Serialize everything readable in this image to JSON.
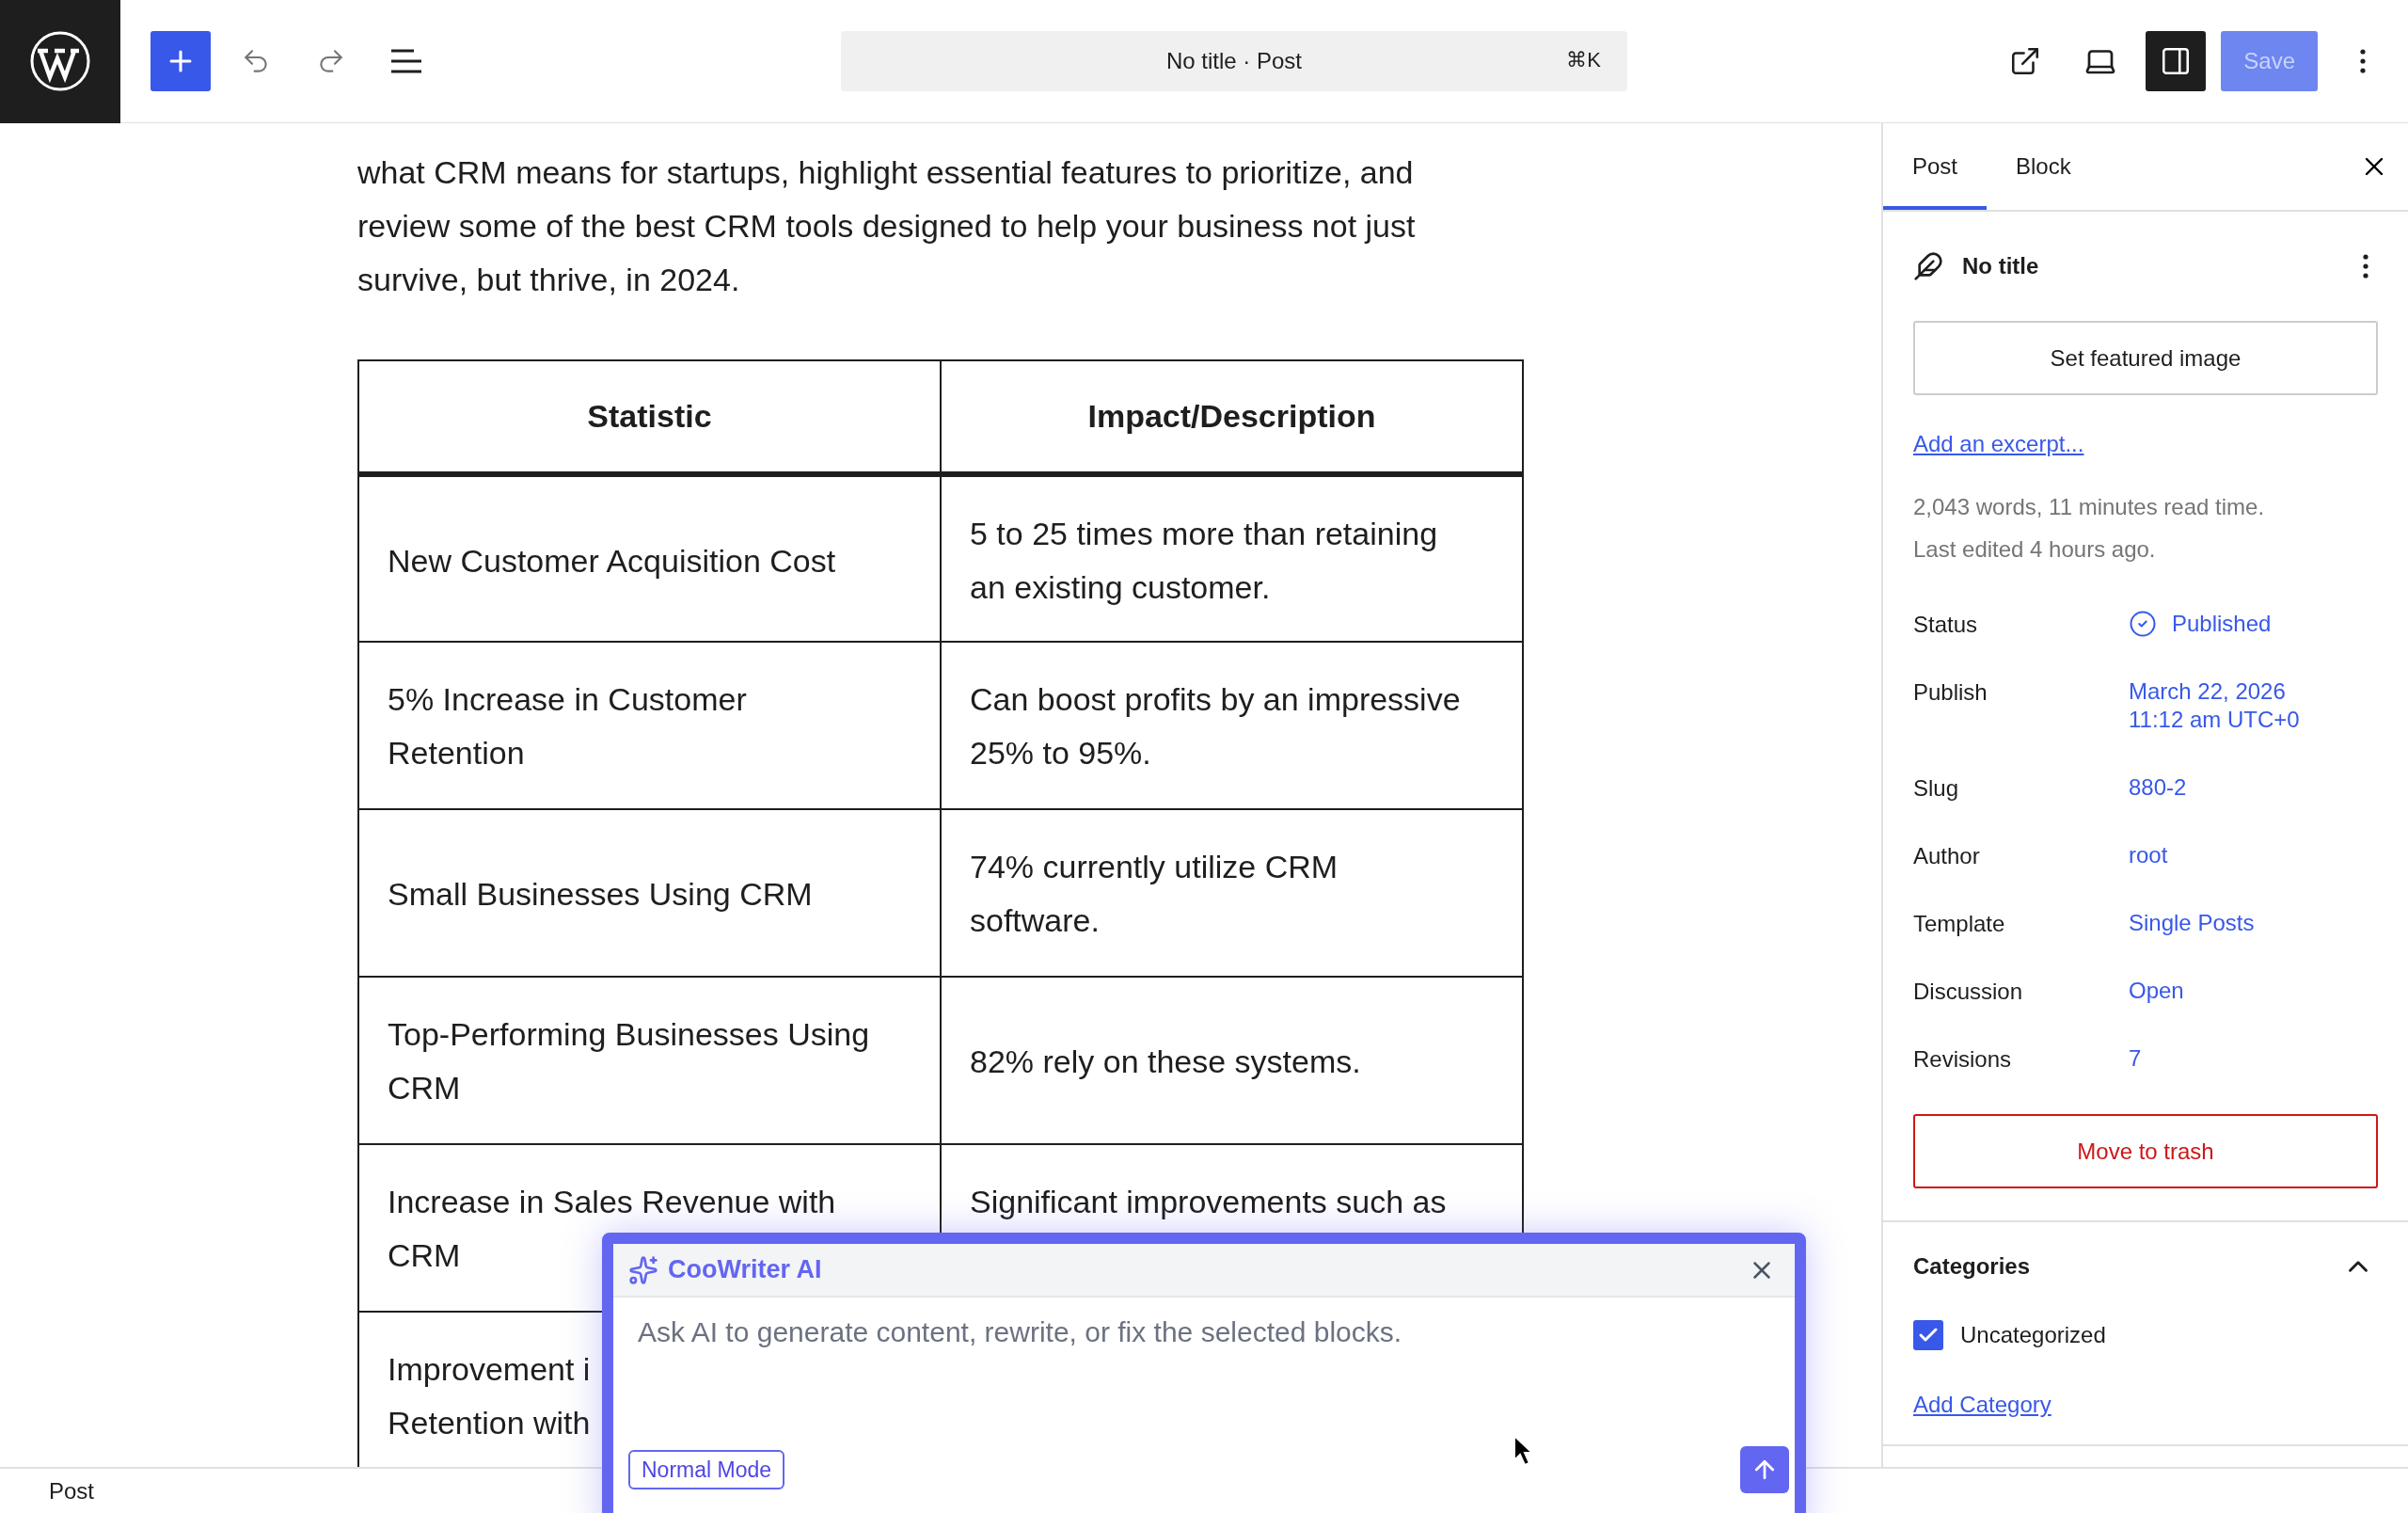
{
  "toolbar": {
    "document_title": "No title · Post",
    "shortcut": "⌘K",
    "save": {
      "label": "Save",
      "disabled": true
    }
  },
  "content": {
    "paragraph": "what CRM means for startups, highlight essential features to prioritize, and review some of the best CRM tools designed to help your business not just survive, but thrive, in 2024."
  },
  "table": {
    "columns": [
      "Statistic",
      "Impact/Description"
    ],
    "rows": [
      {
        "cells": [
          "New Customer Acquisition Cost",
          "5 to 25 times more than retaining\nan existing customer."
        ]
      },
      {
        "cells": [
          "5% Increase in Customer\nRetention",
          "Can boost profits by an impressive\n25% to 95%."
        ]
      },
      {
        "cells": [
          "Small Businesses Using CRM",
          "74% currently utilize CRM\nsoftware."
        ]
      },
      {
        "cells": [
          "Top-Performing Businesses Using\nCRM",
          "82% rely on these systems."
        ]
      },
      {
        "cells": [
          "Increase in Sales Revenue with\nCRM",
          "Significant improvements such as"
        ]
      },
      {
        "cells": [
          "Improvement i\nRetention with"
        ]
      }
    ]
  },
  "sidebar": {
    "tabs": [
      {
        "label": "Post",
        "selected": true
      },
      {
        "label": "Block",
        "selected": false
      }
    ],
    "post_title": "No title",
    "featured_image_button": "Set featured image",
    "excerpt_link": "Add an excerpt...",
    "stats": [
      "2,043 words, 11 minutes read time.",
      "Last edited 4 hours ago."
    ],
    "fields": [
      {
        "kind": "status",
        "label": "Status",
        "value": "Published"
      },
      {
        "kind": "text",
        "label": "Publish",
        "value": "March 22, 2026\n11:12 am UTC+0"
      },
      {
        "kind": "text",
        "label": "Slug",
        "value": "880-2"
      },
      {
        "kind": "text",
        "label": "Author",
        "value": "root"
      },
      {
        "kind": "text",
        "label": "Template",
        "value": "Single Posts"
      },
      {
        "kind": "text",
        "label": "Discussion",
        "value": "Open"
      },
      {
        "kind": "text",
        "label": "Revisions",
        "value": "7"
      }
    ],
    "trash_button": "Move to trash",
    "categories": {
      "title": "Categories",
      "expanded": true,
      "items": [
        {
          "label": "Uncategorized",
          "checked": true
        }
      ],
      "add_link": "Add Category"
    }
  },
  "ai_popup": {
    "title": "CooWriter AI",
    "placeholder": "Ask AI to generate content, rewrite, or fix the selected blocks.",
    "mode": "Normal Mode"
  },
  "status_bar": {
    "breadcrumb": "Post"
  }
}
